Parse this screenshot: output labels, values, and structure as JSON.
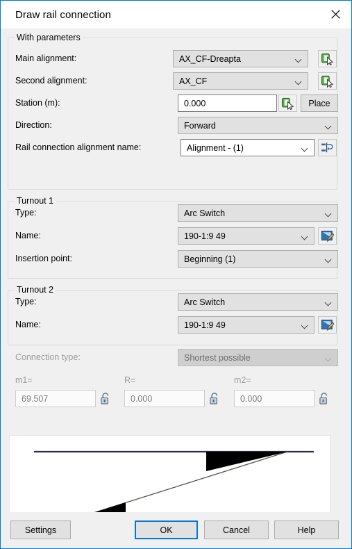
{
  "window": {
    "title": "Draw rail connection",
    "close_icon": "close-icon"
  },
  "groups": {
    "with_parameters": {
      "title": "With parameters"
    },
    "turnout1": {
      "title": "Turnout 1"
    },
    "turnout2": {
      "title": "Turnout 2"
    }
  },
  "fields": {
    "main_alignment": {
      "label": "Main alignment:",
      "value": "AX_CF-Dreapta",
      "pick_icon": "pick-object-icon"
    },
    "second_alignment": {
      "label": "Second alignment:",
      "value": "AX_CF",
      "pick_icon": "pick-object-icon"
    },
    "station": {
      "label": "Station (m):",
      "value": "0.000",
      "pick_icon": "pick-object-icon",
      "place_label": "Place"
    },
    "direction": {
      "label": "Direction:",
      "value": "Forward"
    },
    "rail_connection_name": {
      "label": "Rail connection alignment name:",
      "value": "Alignment - (1)",
      "rename_icon": "connection-rename-icon"
    },
    "turnout1_type": {
      "label": "Type:",
      "value": "Arc Switch"
    },
    "turnout1_name": {
      "label": "Name:",
      "value": "190-1:9 49",
      "edit_icon": "edit-pencil-icon"
    },
    "turnout1_insertion": {
      "label": "Insertion point:",
      "value": "Beginning (1)"
    },
    "turnout2_type": {
      "label": "Type:",
      "value": "Arc Switch"
    },
    "turnout2_name": {
      "label": "Name:",
      "value": "190-1:9 49",
      "edit_icon": "edit-pencil-icon"
    },
    "connection_type": {
      "label": "Connection type:",
      "value": "Shortest possible",
      "disabled": true
    }
  },
  "measures": [
    {
      "label": "m1=",
      "value": "69.507",
      "lock_icon": "unlocked-padlock-icon"
    },
    {
      "label": "R=",
      "value": "0.000",
      "lock_icon": "unlocked-padlock-icon"
    },
    {
      "label": "m2=",
      "value": "0.000",
      "lock_icon": "unlocked-padlock-icon"
    }
  ],
  "preview": {
    "name": "rail-connection-preview",
    "top_track_color": "#2e2a55",
    "bottom_track_color": "#93917c",
    "turnout_fill": "#000000"
  },
  "footer": {
    "settings": "Settings",
    "ok": "OK",
    "cancel": "Cancel",
    "help": "Help"
  }
}
